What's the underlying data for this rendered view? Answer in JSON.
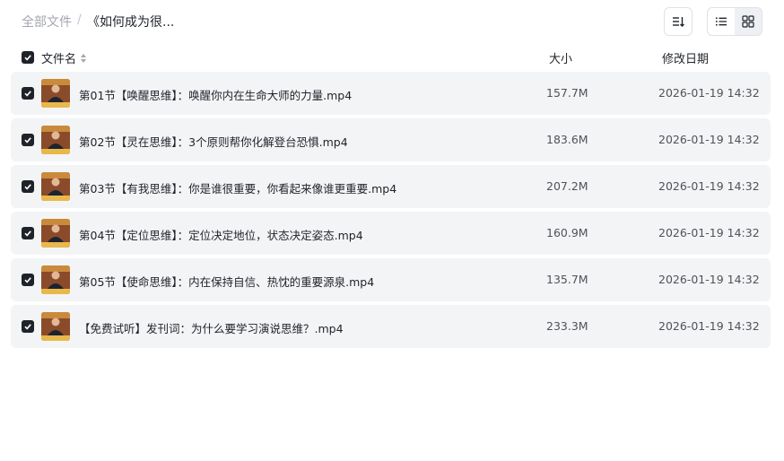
{
  "breadcrumb": {
    "root": "全部文件",
    "separator": "/",
    "current": "《如何成为很..."
  },
  "toolbar": {
    "sort_icon": "sort-descending-icon",
    "list_view_icon": "list-view-icon",
    "grid_view_icon": "grid-view-icon",
    "active_view": "grid"
  },
  "columns": {
    "name": "文件名",
    "size": "大小",
    "date": "修改日期"
  },
  "colors": {
    "row_background": "#f3f4f6",
    "checkbox": "#1f2329"
  },
  "files": [
    {
      "name": "第01节【唤醒思维】：唤醒你内在生命大师的力量.mp4",
      "size": "157.7M",
      "date": "2026-01-19 14:32",
      "checked": true
    },
    {
      "name": "第02节【灵在思维】：3个原则帮你化解登台恐惧.mp4",
      "size": "183.6M",
      "date": "2026-01-19 14:32",
      "checked": true
    },
    {
      "name": "第03节【有我思维】：你是谁很重要，你看起来像谁更重要.mp4",
      "size": "207.2M",
      "date": "2026-01-19 14:32",
      "checked": true
    },
    {
      "name": "第04节【定位思维】：定位决定地位，状态决定姿态.mp4",
      "size": "160.9M",
      "date": "2026-01-19 14:32",
      "checked": true
    },
    {
      "name": "第05节【使命思维】：内在保持自信、热忱的重要源泉.mp4",
      "size": "135.7M",
      "date": "2026-01-19 14:32",
      "checked": true
    },
    {
      "name": "【免费试听】发刊词：为什么要学习演说思维？.mp4",
      "size": "233.3M",
      "date": "2026-01-19 14:32",
      "checked": true
    }
  ]
}
